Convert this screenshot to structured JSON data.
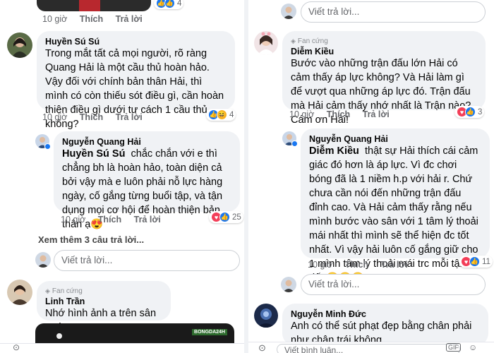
{
  "left": {
    "top_comment": {
      "time": "10 giờ",
      "like": "Thích",
      "reply": "Trả lời",
      "react_count": "4"
    },
    "c1": {
      "author": "Huyền Sú Sú",
      "text": "Trong mắt tất cả mọi người, rõ ràng Quang Hải là một cầu thủ hoàn hảo. Vậy đối với chính bản thân Hải, thì mình có còn thiếu sót điều gì, cần hoàn thiện điều gì dưới tư cách 1 cầu thủ không?",
      "time": "10 giờ",
      "like": "Thích",
      "reply": "Trả lời",
      "react_count": "4"
    },
    "r1": {
      "author": "Nguyễn Quang Hải",
      "mention": "Huyền Sú Sú",
      "text": "chắc chắn với e thì chẳng bh là hoàn hảo, toàn diện cả bởi vậy mà e luôn phải nỗ lực hàng ngày, cố gắng từng buổi tập, và tận dụng mọi cơ hội để hoàn thiện bản thân ạ😍",
      "time": "10 giờ",
      "like": "Thích",
      "reply": "Trả lời",
      "react_count": "25"
    },
    "see_more": "Xem thêm 3 câu trả lời...",
    "reply_placeholder": "Viết trả lời...",
    "c2": {
      "badge": "Fan cứng",
      "author": "Linh Trần",
      "text": "Nhớ hình ảnh a trên sân quá"
    },
    "image_watermark": "BONGDA24H"
  },
  "right": {
    "reply_placeholder_top": "Viết trả lời...",
    "c1": {
      "badge": "Fan cứng",
      "author": "Diễm Kiều",
      "text": "Bước vào những trận đấu lớn Hải có cảm thấy áp lực không? Và Hải làm gì để vượt qua những áp lực đó. Trận đấu mà Hải cảm thấy nhớ nhất là Trận nào? Cám ơn Hải!",
      "time": "10 giờ",
      "like": "Thích",
      "reply": "Trả lời",
      "react_count": "3"
    },
    "r1": {
      "author": "Nguyễn Quang Hải",
      "mention": "Diễm Kiều",
      "text": "thật sự Hải thích cái cảm giác đó hơn là áp lực. Vì đc chơi bóng đã là 1 niềm h.p với hải r. Chứ chưa cần nói đến những trận đấu đỉnh cao. Và Hải cảm thấy rằng nếu mình bước vào sân với 1 tâm lý thoải mái nhất thì mình sẽ thể hiện đc tốt nhất. Vì vậy hải luôn cố gắng giữ cho 1 mình tâm lý thoải mái trc mỗi tận đấu☺️☺️☺️",
      "time": "10 giờ",
      "like": "Thích",
      "reply": "Trả lời",
      "react_count": "11"
    },
    "reply_placeholder": "Viết trả lời...",
    "c2": {
      "author": "Nguyễn Minh Đức",
      "text": "Anh có thể sút phạt đẹp bằng chân phải như chân trái không"
    },
    "bottom_placeholder": "Viết bình luận..."
  },
  "colors": {
    "bubble": "#f0f2f5",
    "meta": "#65676b",
    "like_blue": "#1877f2",
    "heart_red": "#f33e58",
    "verified_blue": "#1877f2"
  }
}
